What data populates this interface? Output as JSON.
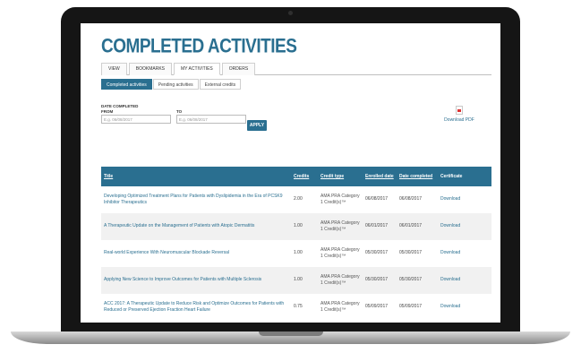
{
  "page": {
    "title": "COMPLETED ACTIVITIES"
  },
  "tabs": [
    {
      "label": "VIEW",
      "active": false
    },
    {
      "label": "BOOKMARKS",
      "active": false
    },
    {
      "label": "MY ACTIVITIES",
      "active": true
    },
    {
      "label": "ORDERS",
      "active": false
    }
  ],
  "subtabs": [
    {
      "label": "Completed activities",
      "active": true
    },
    {
      "label": "Pending activities",
      "active": false
    },
    {
      "label": "External credits",
      "active": false
    }
  ],
  "filters": {
    "heading": "DATE COMPLETED",
    "from_label": "FROM",
    "to_label": "TO",
    "from_placeholder": "E.g. 06/08/2017",
    "to_placeholder": "E.g. 06/08/2017",
    "apply_label": "APPLY"
  },
  "download_pdf": "Download PDF",
  "table": {
    "headers": {
      "title": "Title",
      "credits": "Credits",
      "credit_type": "Credit type",
      "enrolled": "Enrolled date",
      "completed": "Date completed",
      "certificate": "Certificate"
    },
    "rows": [
      {
        "title": "Developing Optimized Treatment Plans for Patients with Dyslipidemia in the Era of PCSK9 Inhibitor Therapeutics",
        "credits": "2.00",
        "credit_type": "AMA PRA Category 1 Credit(s)™",
        "enrolled": "06/08/2017",
        "completed": "06/08/2017",
        "certificate": "Download"
      },
      {
        "title": "A Therapeutic Update on the Management of Patients with Atopic Dermatitis",
        "credits": "1.00",
        "credit_type": "AMA PRA Category 1 Credit(s)™",
        "enrolled": "06/01/2017",
        "completed": "06/01/2017",
        "certificate": "Download"
      },
      {
        "title": "Real-world Experience With Neuromuscular Blockade Reversal",
        "credits": "1.00",
        "credit_type": "AMA PRA Category 1 Credit(s)™",
        "enrolled": "05/30/2017",
        "completed": "05/30/2017",
        "certificate": "Download"
      },
      {
        "title": "Applying New Science to Improve Outcomes for Patients with Multiple Sclerosis",
        "credits": "1.00",
        "credit_type": "AMA PRA Category 1 Credit(s)™",
        "enrolled": "05/30/2017",
        "completed": "05/30/2017",
        "certificate": "Download"
      },
      {
        "title": "ACC 2017: A Therapeutic Update to Reduce Risk and Optimize Outcomes for Patients with Reduced or Preserved Ejection Fraction Heart Failure",
        "credits": "0.75",
        "credit_type": "AMA PRA Category 1 Credit(s)™",
        "enrolled": "05/09/2017",
        "completed": "05/09/2017",
        "certificate": "Download"
      }
    ]
  }
}
